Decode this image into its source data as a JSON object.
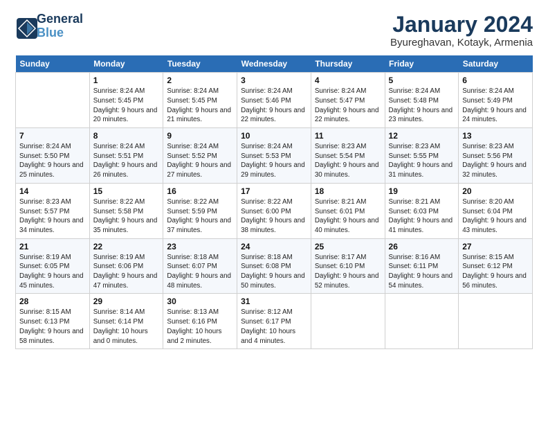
{
  "logo": {
    "line1": "General",
    "line2": "Blue"
  },
  "title": "January 2024",
  "subtitle": "Byureghavan, Kotayk, Armenia",
  "days_of_week": [
    "Sunday",
    "Monday",
    "Tuesday",
    "Wednesday",
    "Thursday",
    "Friday",
    "Saturday"
  ],
  "weeks": [
    [
      {
        "day": "",
        "sunrise": "",
        "sunset": "",
        "daylight": ""
      },
      {
        "day": "1",
        "sunrise": "Sunrise: 8:24 AM",
        "sunset": "Sunset: 5:45 PM",
        "daylight": "Daylight: 9 hours and 20 minutes."
      },
      {
        "day": "2",
        "sunrise": "Sunrise: 8:24 AM",
        "sunset": "Sunset: 5:45 PM",
        "daylight": "Daylight: 9 hours and 21 minutes."
      },
      {
        "day": "3",
        "sunrise": "Sunrise: 8:24 AM",
        "sunset": "Sunset: 5:46 PM",
        "daylight": "Daylight: 9 hours and 22 minutes."
      },
      {
        "day": "4",
        "sunrise": "Sunrise: 8:24 AM",
        "sunset": "Sunset: 5:47 PM",
        "daylight": "Daylight: 9 hours and 22 minutes."
      },
      {
        "day": "5",
        "sunrise": "Sunrise: 8:24 AM",
        "sunset": "Sunset: 5:48 PM",
        "daylight": "Daylight: 9 hours and 23 minutes."
      },
      {
        "day": "6",
        "sunrise": "Sunrise: 8:24 AM",
        "sunset": "Sunset: 5:49 PM",
        "daylight": "Daylight: 9 hours and 24 minutes."
      }
    ],
    [
      {
        "day": "7",
        "sunrise": "Sunrise: 8:24 AM",
        "sunset": "Sunset: 5:50 PM",
        "daylight": "Daylight: 9 hours and 25 minutes."
      },
      {
        "day": "8",
        "sunrise": "Sunrise: 8:24 AM",
        "sunset": "Sunset: 5:51 PM",
        "daylight": "Daylight: 9 hours and 26 minutes."
      },
      {
        "day": "9",
        "sunrise": "Sunrise: 8:24 AM",
        "sunset": "Sunset: 5:52 PM",
        "daylight": "Daylight: 9 hours and 27 minutes."
      },
      {
        "day": "10",
        "sunrise": "Sunrise: 8:24 AM",
        "sunset": "Sunset: 5:53 PM",
        "daylight": "Daylight: 9 hours and 29 minutes."
      },
      {
        "day": "11",
        "sunrise": "Sunrise: 8:23 AM",
        "sunset": "Sunset: 5:54 PM",
        "daylight": "Daylight: 9 hours and 30 minutes."
      },
      {
        "day": "12",
        "sunrise": "Sunrise: 8:23 AM",
        "sunset": "Sunset: 5:55 PM",
        "daylight": "Daylight: 9 hours and 31 minutes."
      },
      {
        "day": "13",
        "sunrise": "Sunrise: 8:23 AM",
        "sunset": "Sunset: 5:56 PM",
        "daylight": "Daylight: 9 hours and 32 minutes."
      }
    ],
    [
      {
        "day": "14",
        "sunrise": "Sunrise: 8:23 AM",
        "sunset": "Sunset: 5:57 PM",
        "daylight": "Daylight: 9 hours and 34 minutes."
      },
      {
        "day": "15",
        "sunrise": "Sunrise: 8:22 AM",
        "sunset": "Sunset: 5:58 PM",
        "daylight": "Daylight: 9 hours and 35 minutes."
      },
      {
        "day": "16",
        "sunrise": "Sunrise: 8:22 AM",
        "sunset": "Sunset: 5:59 PM",
        "daylight": "Daylight: 9 hours and 37 minutes."
      },
      {
        "day": "17",
        "sunrise": "Sunrise: 8:22 AM",
        "sunset": "Sunset: 6:00 PM",
        "daylight": "Daylight: 9 hours and 38 minutes."
      },
      {
        "day": "18",
        "sunrise": "Sunrise: 8:21 AM",
        "sunset": "Sunset: 6:01 PM",
        "daylight": "Daylight: 9 hours and 40 minutes."
      },
      {
        "day": "19",
        "sunrise": "Sunrise: 8:21 AM",
        "sunset": "Sunset: 6:03 PM",
        "daylight": "Daylight: 9 hours and 41 minutes."
      },
      {
        "day": "20",
        "sunrise": "Sunrise: 8:20 AM",
        "sunset": "Sunset: 6:04 PM",
        "daylight": "Daylight: 9 hours and 43 minutes."
      }
    ],
    [
      {
        "day": "21",
        "sunrise": "Sunrise: 8:19 AM",
        "sunset": "Sunset: 6:05 PM",
        "daylight": "Daylight: 9 hours and 45 minutes."
      },
      {
        "day": "22",
        "sunrise": "Sunrise: 8:19 AM",
        "sunset": "Sunset: 6:06 PM",
        "daylight": "Daylight: 9 hours and 47 minutes."
      },
      {
        "day": "23",
        "sunrise": "Sunrise: 8:18 AM",
        "sunset": "Sunset: 6:07 PM",
        "daylight": "Daylight: 9 hours and 48 minutes."
      },
      {
        "day": "24",
        "sunrise": "Sunrise: 8:18 AM",
        "sunset": "Sunset: 6:08 PM",
        "daylight": "Daylight: 9 hours and 50 minutes."
      },
      {
        "day": "25",
        "sunrise": "Sunrise: 8:17 AM",
        "sunset": "Sunset: 6:10 PM",
        "daylight": "Daylight: 9 hours and 52 minutes."
      },
      {
        "day": "26",
        "sunrise": "Sunrise: 8:16 AM",
        "sunset": "Sunset: 6:11 PM",
        "daylight": "Daylight: 9 hours and 54 minutes."
      },
      {
        "day": "27",
        "sunrise": "Sunrise: 8:15 AM",
        "sunset": "Sunset: 6:12 PM",
        "daylight": "Daylight: 9 hours and 56 minutes."
      }
    ],
    [
      {
        "day": "28",
        "sunrise": "Sunrise: 8:15 AM",
        "sunset": "Sunset: 6:13 PM",
        "daylight": "Daylight: 9 hours and 58 minutes."
      },
      {
        "day": "29",
        "sunrise": "Sunrise: 8:14 AM",
        "sunset": "Sunset: 6:14 PM",
        "daylight": "Daylight: 10 hours and 0 minutes."
      },
      {
        "day": "30",
        "sunrise": "Sunrise: 8:13 AM",
        "sunset": "Sunset: 6:16 PM",
        "daylight": "Daylight: 10 hours and 2 minutes."
      },
      {
        "day": "31",
        "sunrise": "Sunrise: 8:12 AM",
        "sunset": "Sunset: 6:17 PM",
        "daylight": "Daylight: 10 hours and 4 minutes."
      },
      {
        "day": "",
        "sunrise": "",
        "sunset": "",
        "daylight": ""
      },
      {
        "day": "",
        "sunrise": "",
        "sunset": "",
        "daylight": ""
      },
      {
        "day": "",
        "sunrise": "",
        "sunset": "",
        "daylight": ""
      }
    ]
  ]
}
